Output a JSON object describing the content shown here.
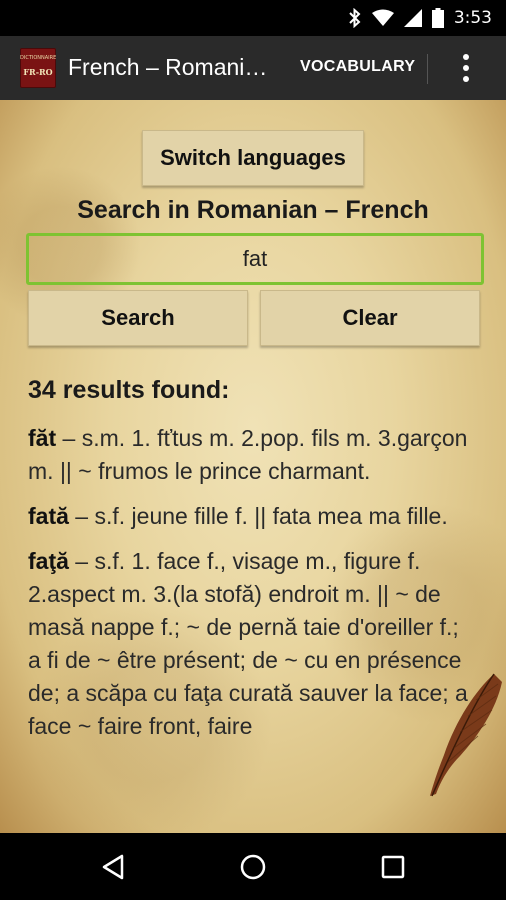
{
  "status": {
    "time": "3:53"
  },
  "actionbar": {
    "app_icon_top": "DICTIONNAIRE",
    "app_icon_main": "FR-RO",
    "title": "French – Romani…",
    "vocabulary": "VOCABULARY"
  },
  "main": {
    "switch_label": "Switch languages",
    "search_heading": "Search in Romanian – French",
    "search_value": "fat",
    "search_label": "Search",
    "clear_label": "Clear",
    "results_count": "34 results found:",
    "entries": [
      {
        "term": "făt",
        "definition": " – s.m. 1. fťtus m. 2.pop. fils m. 3.garçon m. || ~ frumos le prince charmant."
      },
      {
        "term": "fată",
        "definition": " – s.f. jeune fille f. || fata mea ma fille."
      },
      {
        "term": "faţă",
        "definition": " – s.f. 1. face f., visage m., figure f. 2.aspect m. 3.(la stofă) endroit m. || ~ de masă nappe f.; ~ de pernă taie d'oreiller f.; a fi de ~ être présent; de ~ cu en présence de; a scăpa cu faţa curată sauver la face; a face ~ faire front, faire"
      }
    ]
  },
  "colors": {
    "accent": "#7ec332",
    "actionbar": "#2a2a2a",
    "parchment": "#e8d59f"
  },
  "icons": {
    "status": [
      "bluetooth-icon",
      "wifi-icon",
      "signal-icon",
      "battery-icon"
    ],
    "nav": [
      "back-icon",
      "home-icon",
      "recents-icon"
    ],
    "overflow": "overflow-menu-icon"
  }
}
